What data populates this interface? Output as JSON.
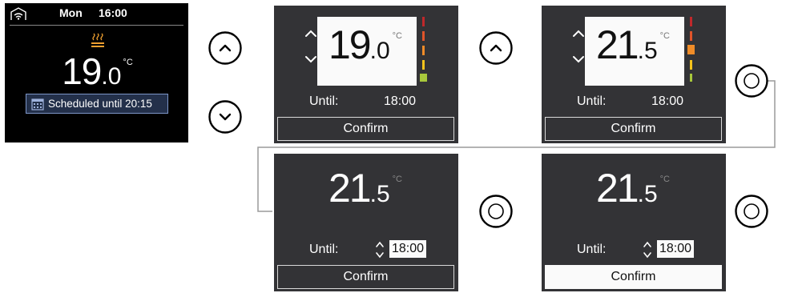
{
  "home": {
    "day": "Mon",
    "time": "16:00",
    "temp_int": "19",
    "temp_dec": ".0",
    "unit": "°C",
    "schedule_text": "Scheduled until 20:15",
    "icons": [
      "wifi-icon",
      "heating-icon",
      "calendar-icon"
    ]
  },
  "buttons": [
    "chevron-up-button",
    "chevron-down-button",
    "select-button"
  ],
  "panels": [
    {
      "temp_int": "19",
      "temp_dec": ".0",
      "unit": "°C",
      "until_label": "Until:",
      "until_value": "18:00",
      "confirm_label": "Confirm"
    },
    {
      "temp_int": "21",
      "temp_dec": ".5",
      "unit": "°C",
      "until_label": "Until:",
      "until_value": "18:00",
      "confirm_label": "Confirm"
    },
    {
      "temp_int": "21",
      "temp_dec": ".5",
      "unit": "°C",
      "until_label": "Until:",
      "until_value": "18:00",
      "confirm_label": "Confirm"
    },
    {
      "temp_int": "21",
      "temp_dec": ".5",
      "unit": "°C",
      "until_label": "Until:",
      "until_value": "18:00",
      "confirm_label": "Confirm"
    }
  ],
  "colors": {
    "home_bg": "#000000",
    "panel_bg": "#333336",
    "schedule_bg": "#23304a",
    "schedule_border": "#7d96c8",
    "heat_icon": "#f0a030",
    "level_scale": [
      "#c0282b",
      "#e0542a",
      "#f08c28",
      "#f5c31c",
      "#a8c83c"
    ]
  }
}
